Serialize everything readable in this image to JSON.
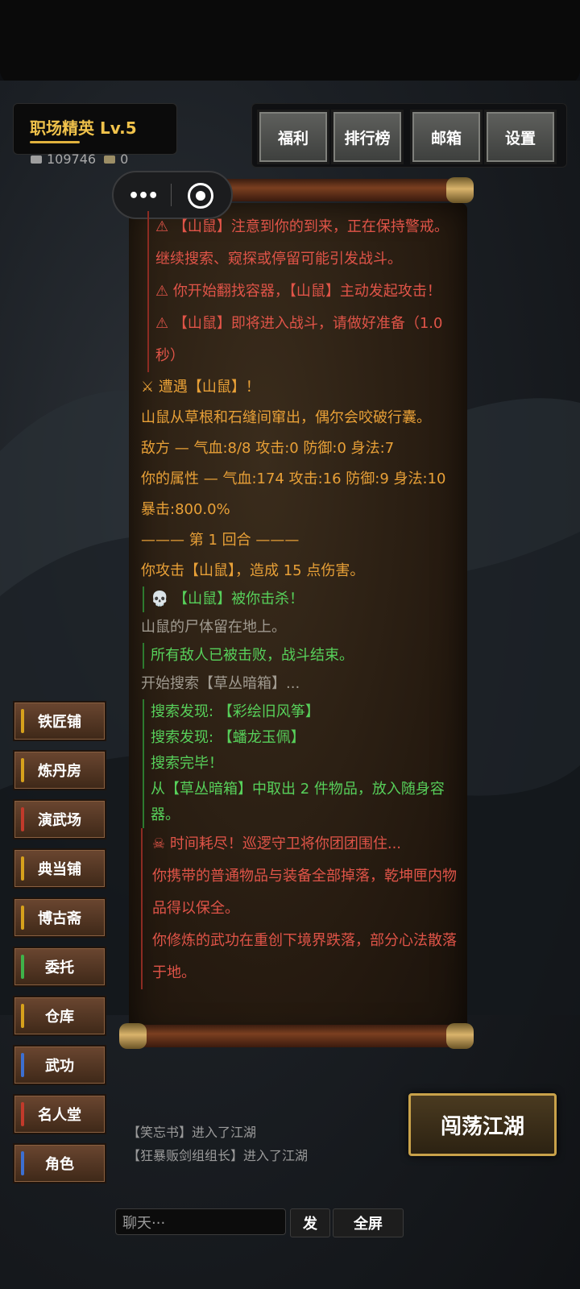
{
  "player": {
    "title": "职场精英  Lv.5",
    "silver": "109746",
    "notes": "0"
  },
  "top_buttons": [
    "福利",
    "排行榜",
    "邮箱",
    "设置"
  ],
  "capsule": {
    "more": "•••"
  },
  "log": [
    {
      "type": "red",
      "text": "⚠ 【山鼠】注意到你的到来，正在保持警戒。继续搜索、窥探或停留可能引发战斗。"
    },
    {
      "type": "red",
      "text": "⚠ 你开始翻找容器，【山鼠】主动发起攻击！"
    },
    {
      "type": "red",
      "text": "⚠ 【山鼠】即将进入战斗，请做好准备（1.0秒）"
    },
    {
      "type": "orange",
      "text": "⚔ 遭遇【山鼠】！"
    },
    {
      "type": "orange",
      "text": "山鼠从草根和石缝间窜出，偶尔会咬破行囊。"
    },
    {
      "type": "orange",
      "text": "敌方 — 气血:8/8 攻击:0 防御:0 身法:7"
    },
    {
      "type": "orange",
      "text": " 你的属性 — 气血:174 攻击:16 防御:9 身法:10 暴击:800.0%"
    },
    {
      "type": "orange",
      "text": "——— 第 1 回合 ———"
    },
    {
      "type": "orange",
      "text": " 你攻击【山鼠】，造成 15 点伤害。"
    },
    {
      "type": "green",
      "text": "💀 【山鼠】被你击杀！"
    },
    {
      "type": "grey",
      "text": "山鼠的尸体留在地上。"
    },
    {
      "type": "green",
      "text": "所有敌人已被击败，战斗结束。"
    },
    {
      "type": "grey",
      "text": "开始搜索【草丛暗箱】..."
    },
    {
      "type": "green",
      "text": "搜索发现: 【彩绘旧风筝】"
    },
    {
      "type": "green",
      "text": "搜索发现: 【蟠龙玉佩】"
    },
    {
      "type": "green",
      "text": "搜索完毕！"
    },
    {
      "type": "green",
      "text": "从【草丛暗箱】中取出 2 件物品，放入随身容器。"
    },
    {
      "type": "red2",
      "text": "☠ 时间耗尽！巡逻守卫将你团团围住..."
    },
    {
      "type": "red2",
      "text": "你携带的普通物品与装备全部掉落，乾坤匣内物品得以保全。"
    },
    {
      "type": "red2",
      "text": "你修炼的武功在重创下境界跌落，部分心法散落于地。"
    }
  ],
  "menu": [
    {
      "label": "铁匠铺",
      "color": "#d6a11c"
    },
    {
      "label": "炼丹房",
      "color": "#d6a11c"
    },
    {
      "label": "演武场",
      "color": "#c23a2b"
    },
    {
      "label": "典当铺",
      "color": "#d6a11c"
    },
    {
      "label": "博古斋",
      "color": "#d6a11c"
    },
    {
      "label": "委托",
      "color": "#3fb34a"
    },
    {
      "label": "仓库",
      "color": "#d6a11c"
    },
    {
      "label": "武功",
      "color": "#3c6fd1"
    },
    {
      "label": "名人堂",
      "color": "#c23a2b"
    },
    {
      "label": "角色",
      "color": "#3c6fd1"
    }
  ],
  "roam_button": "闯荡江湖",
  "system_messages": [
    "【笑忘书】进入了江湖",
    "【狂暴贩剑组组长】进入了江湖"
  ],
  "chat": {
    "placeholder": "聊天···",
    "send": "发",
    "fullscreen": "全屏"
  }
}
